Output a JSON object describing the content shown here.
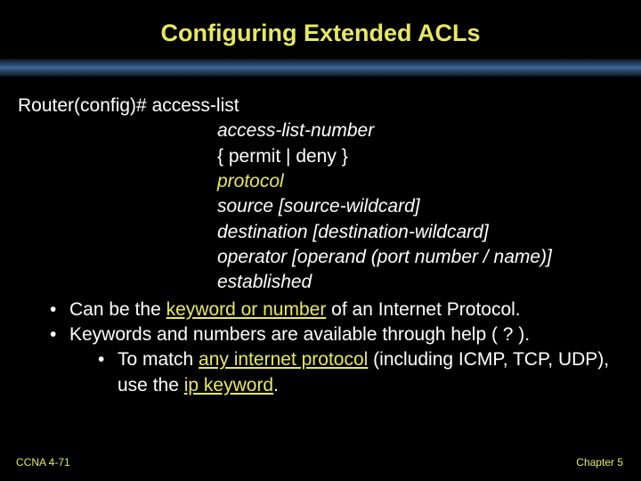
{
  "title": "Configuring Extended ACLs",
  "cmd": {
    "prompt": "Router(config)# access-list",
    "lines": [
      "access-list-number",
      "{ permit | deny }",
      "protocol",
      "source [source-wildcard]",
      "destination [destination-wildcard]",
      "operator [operand (port number / name)]",
      "established"
    ]
  },
  "bullets": [
    {
      "pre": "Can be the ",
      "highlight": "keyword or number",
      "post": " of an Internet Protocol."
    },
    {
      "pre": "Keywords and numbers are available through help ( ? ).",
      "highlight": "",
      "post": ""
    }
  ],
  "subbullet": {
    "pre": "To match ",
    "hl1": "any internet protocol",
    "mid": " (including ICMP, TCP, UDP), use the ",
    "hl2": "ip keyword",
    "post": "."
  },
  "footer": {
    "left": "CCNA 4-71",
    "right": "Chapter 5"
  }
}
